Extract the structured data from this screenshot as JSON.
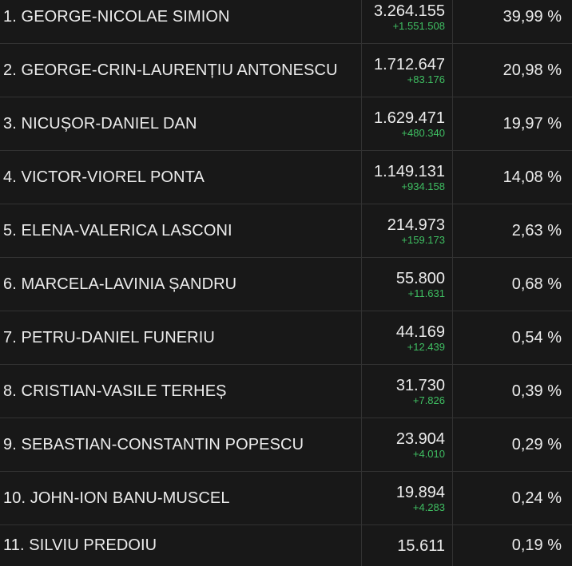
{
  "candidates": [
    {
      "name": "1. GEORGE-NICOLAE SIMION",
      "votes": "3.264.155",
      "delta": "+1.551.508",
      "percent": "39,99 %"
    },
    {
      "name": "2. GEORGE-CRIN-LAURENȚIU ANTONESCU",
      "votes": "1.712.647",
      "delta": "+83.176",
      "percent": "20,98 %"
    },
    {
      "name": "3. NICUȘOR-DANIEL DAN",
      "votes": "1.629.471",
      "delta": "+480.340",
      "percent": "19,97 %"
    },
    {
      "name": "4. VICTOR-VIOREL PONTA",
      "votes": "1.149.131",
      "delta": "+934.158",
      "percent": "14,08 %"
    },
    {
      "name": "5. ELENA-VALERICA LASCONI",
      "votes": "214.973",
      "delta": "+159.173",
      "percent": "2,63 %"
    },
    {
      "name": "6. MARCELA-LAVINIA ȘANDRU",
      "votes": "55.800",
      "delta": "+11.631",
      "percent": "0,68 %"
    },
    {
      "name": "7. PETRU-DANIEL FUNERIU",
      "votes": "44.169",
      "delta": "+12.439",
      "percent": "0,54 %"
    },
    {
      "name": "8. CRISTIAN-VASILE TERHEȘ",
      "votes": "31.730",
      "delta": "+7.826",
      "percent": "0,39 %"
    },
    {
      "name": "9. SEBASTIAN-CONSTANTIN POPESCU",
      "votes": "23.904",
      "delta": "+4.010",
      "percent": "0,29 %"
    },
    {
      "name": "10. JOHN-ION BANU-MUSCEL",
      "votes": "19.894",
      "delta": "+4.283",
      "percent": "0,24 %"
    },
    {
      "name": "11. SILVIU PREDOIU",
      "votes": "15.611",
      "delta": "",
      "percent": "0,19 %"
    }
  ],
  "colors": {
    "background": "#181818",
    "text": "#ececec",
    "delta": "#3fbf62",
    "divider": "#323232"
  }
}
